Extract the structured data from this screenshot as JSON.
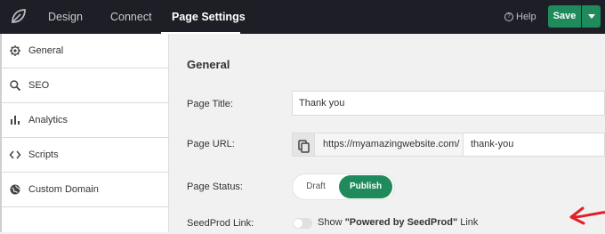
{
  "topbar": {
    "logo_icon": "seedprod-leaf-icon",
    "tabs": [
      {
        "label": "Design"
      },
      {
        "label": "Connect"
      },
      {
        "label": "Page Settings"
      }
    ],
    "help_label": "Help",
    "save_label": "Save"
  },
  "sidebar": {
    "items": [
      {
        "label": "General",
        "icon": "gear-icon"
      },
      {
        "label": "SEO",
        "icon": "search-icon"
      },
      {
        "label": "Analytics",
        "icon": "bar-chart-icon"
      },
      {
        "label": "Scripts",
        "icon": "code-icon"
      },
      {
        "label": "Custom Domain",
        "icon": "globe-icon"
      }
    ]
  },
  "main": {
    "section_title": "General",
    "page_title_label": "Page Title:",
    "page_title_value": "Thank you",
    "page_url_label": "Page URL:",
    "page_url_prefix": "https://myamazingwebsite.com/",
    "page_url_slug": "thank-you",
    "page_status_label": "Page Status:",
    "status_draft": "Draft",
    "status_publish": "Publish",
    "seedprod_label": "SeedProd Link:",
    "seedprod_text_pre": "Show ",
    "seedprod_text_bold": "\"Powered by SeedProd\"",
    "seedprod_text_post": " Link"
  },
  "colors": {
    "topbar_bg": "#1e1e26",
    "accent_green": "#1f8a5c",
    "annotation_arrow": "#e0202a"
  }
}
